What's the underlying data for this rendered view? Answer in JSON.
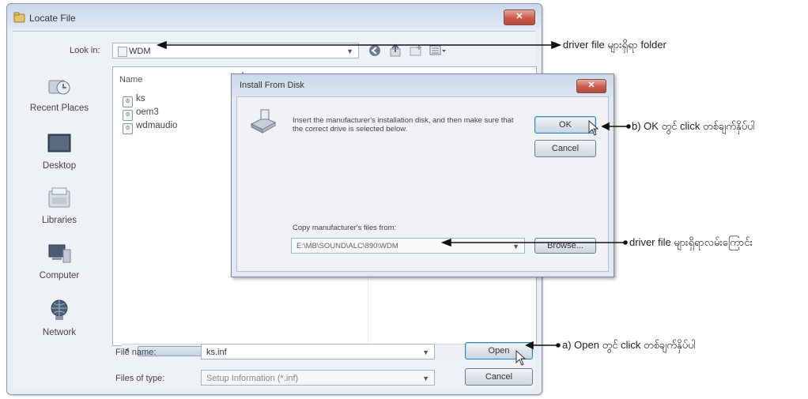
{
  "locate_window": {
    "title": "Locate File",
    "close_label": "✕",
    "look_in_label": "Look in:",
    "look_in_value": "WDM",
    "places": [
      {
        "label": "Recent Places",
        "icon": "recent-places-icon"
      },
      {
        "label": "Desktop",
        "icon": "desktop-icon"
      },
      {
        "label": "Libraries",
        "icon": "libraries-icon"
      },
      {
        "label": "Computer",
        "icon": "computer-icon"
      },
      {
        "label": "Network",
        "icon": "network-icon"
      }
    ],
    "column_name": "Name",
    "files": [
      "ks",
      "oem3",
      "wdmaudio"
    ],
    "scroll_mid": "|||",
    "file_name_label": "File name:",
    "file_name_value": "ks.inf",
    "files_of_type_label": "Files of type:",
    "files_of_type_value": "Setup Information (*.inf)",
    "open_button": "Open",
    "cancel_button": "Cancel"
  },
  "install_dialog": {
    "title": "Install From Disk",
    "message": "Insert the manufacturer's installation disk, and then make sure that the correct drive is selected below.",
    "ok_button": "OK",
    "cancel_button": "Cancel",
    "copy_label": "Copy manufacturer's files from:",
    "path_value": "E:\\MB\\SOUND\\ALC\\890\\WDM",
    "browse_button": "Browse..."
  },
  "annotations": {
    "folder": "driver file များရှိရာ folder",
    "ok": "b) OK တွင် click တစ်ချက်နှိပ်ပါ",
    "path": "driver file များရှိရာလမ်းကြောင်း",
    "open": "a) Open တွင် click တစ်ချက်နှိပ်ပါ"
  }
}
